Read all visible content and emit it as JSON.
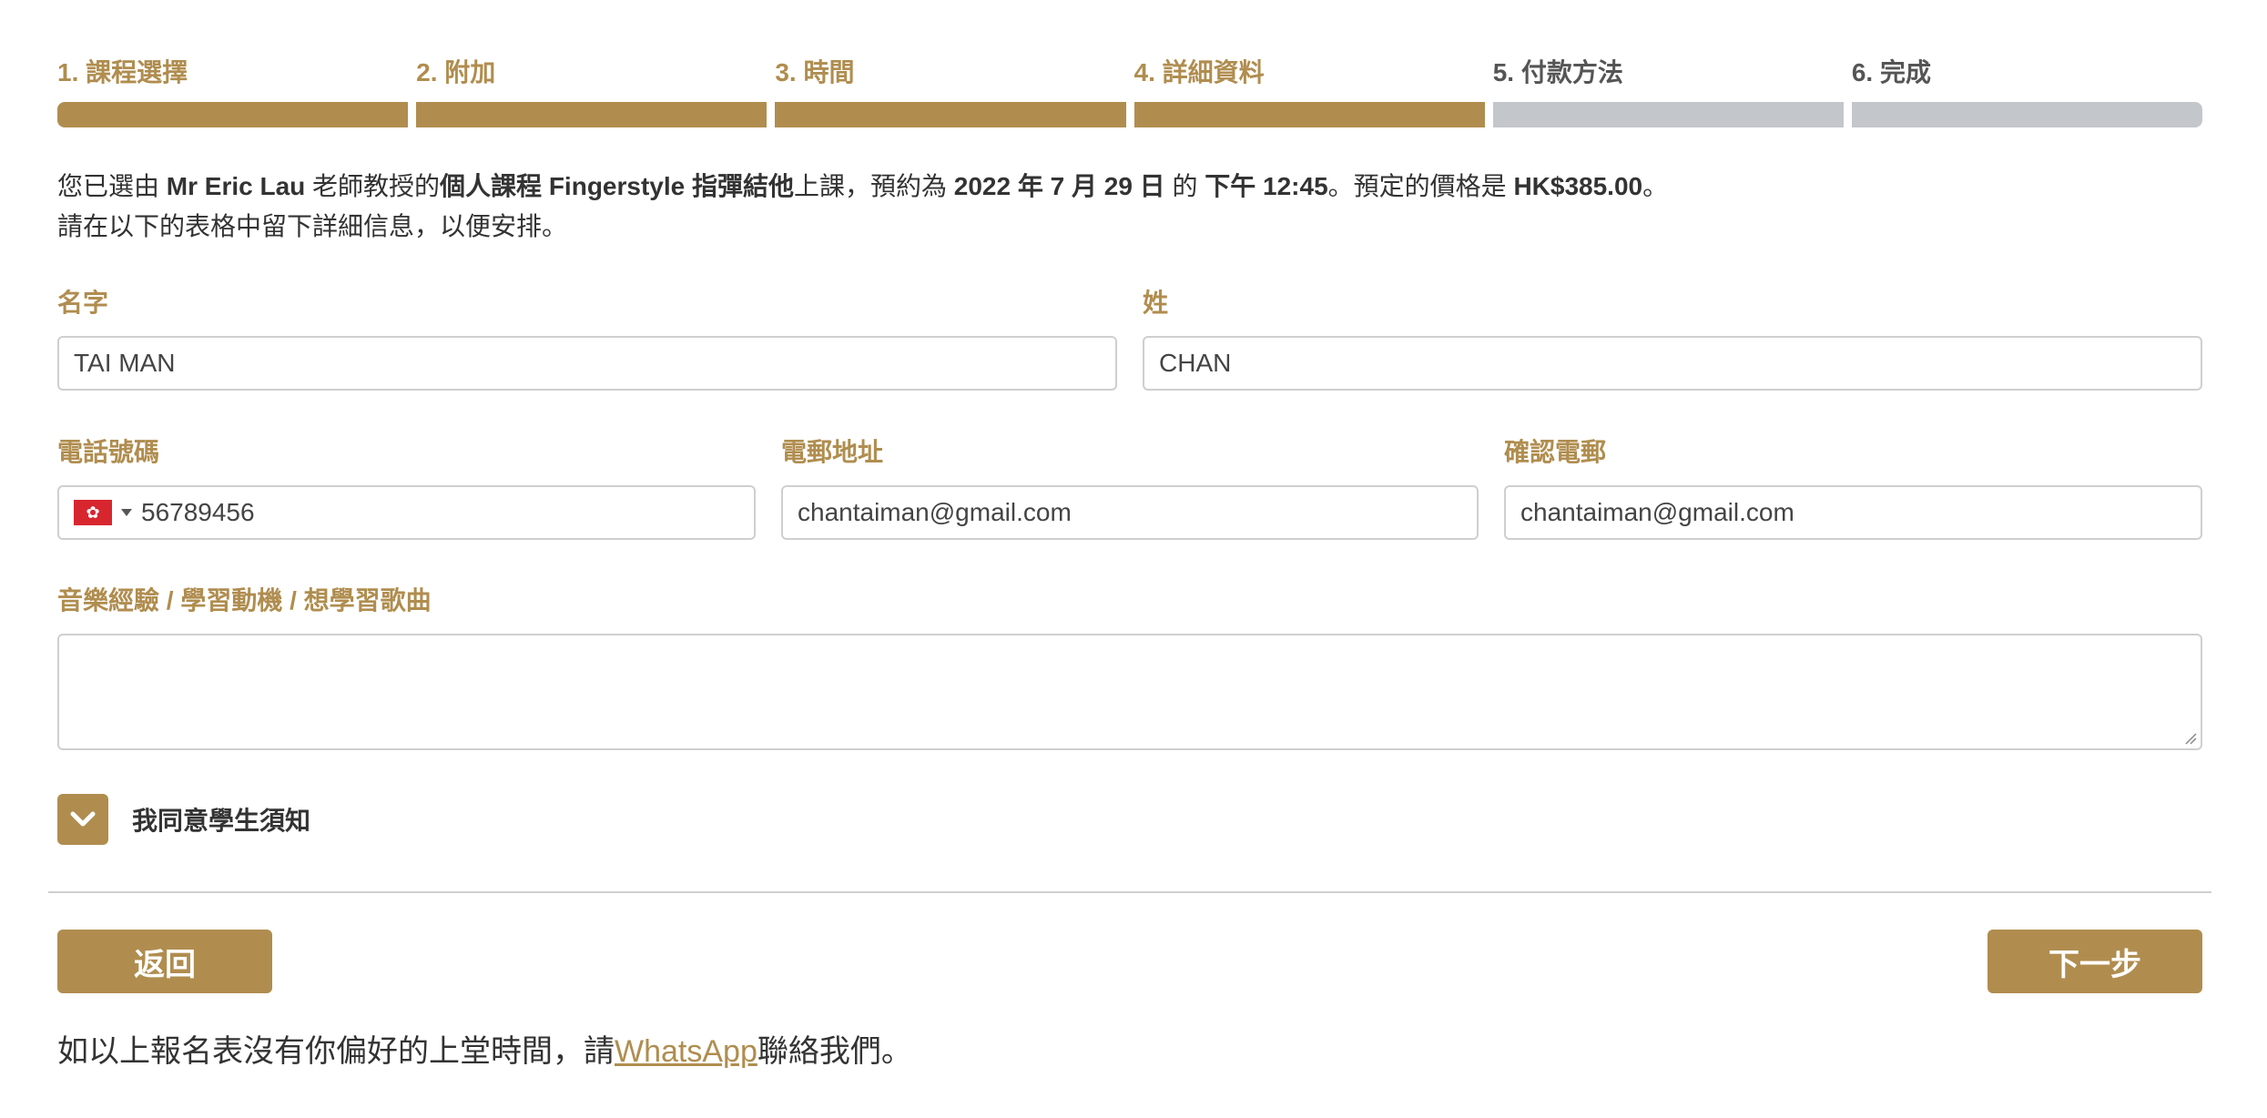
{
  "steps": [
    {
      "label": "1. 課程選擇",
      "state": "done"
    },
    {
      "label": "2. 附加",
      "state": "done"
    },
    {
      "label": "3. 時間",
      "state": "done"
    },
    {
      "label": "4. 詳細資料",
      "state": "current"
    },
    {
      "label": "5. 付款方法",
      "state": "pending"
    },
    {
      "label": "6. 完成",
      "state": "pending"
    }
  ],
  "intro": {
    "t1": "您已選由 ",
    "teacher": "Mr Eric Lau",
    "t2": " 老師教授的",
    "course": "個人課程 Fingerstyle 指彈結他",
    "t3": "上課，預約為 ",
    "date": "2022 年 7 月 29 日",
    "t4": " 的 ",
    "time": "下午 12:45",
    "t5": "。預定的價格是 ",
    "price": "HK$385.00",
    "t6": "。",
    "line2": "請在以下的表格中留下詳細信息，以便安排。"
  },
  "form": {
    "first_name": {
      "label": "名字",
      "value": "TAI MAN"
    },
    "last_name": {
      "label": "姓",
      "value": "CHAN"
    },
    "phone": {
      "label": "電話號碼",
      "value": "56789456",
      "country_flag": "hong-kong-flag"
    },
    "email": {
      "label": "電郵地址",
      "value": "chantaiman@gmail.com"
    },
    "confirm_email": {
      "label": "確認電郵",
      "value": "chantaiman@gmail.com"
    },
    "notes": {
      "label": "音樂經驗 / 學習動機 / 想學習歌曲",
      "value": ""
    }
  },
  "agree": {
    "label": "我同意學生須知",
    "icon": "chevron-down-icon"
  },
  "buttons": {
    "back": "返回",
    "next": "下一步"
  },
  "footer": {
    "before": "如以上報名表沒有你偏好的上堂時間，請",
    "link": "WhatsApp",
    "after": "聯絡我們。"
  },
  "colors": {
    "accent": "#b08d4f",
    "inactive_bar": "#c3c6cb",
    "text": "#333333",
    "border": "#cfcfcf"
  }
}
